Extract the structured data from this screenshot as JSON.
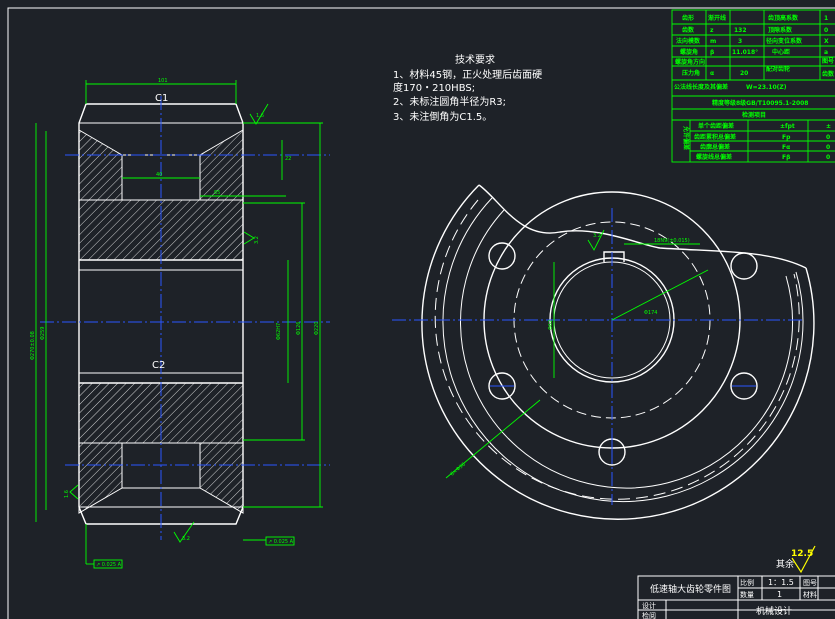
{
  "tech_requirements": {
    "title": "技术要求",
    "line1": "1、材料45钢，正火处理后齿面硬",
    "line2": "度170・210HBS;",
    "line3": "2、未标注圆角半径为R3;",
    "line4": "3、未注倒角为C1.5。"
  },
  "section_view": {
    "chamfer_top": "C1",
    "chamfer_mid": "C2",
    "roughness_top": "1.6",
    "roughness_right": "3.2",
    "roughness_bottom": "3.2",
    "roughness_left": "1.6",
    "dim_top_width": "101",
    "dim_inner_a": "40",
    "dim_inner_b": "85",
    "dim_inner_c": "22",
    "dim_left_outer": "Φ270±0.08",
    "dim_left_inner": "Φ259",
    "dim_right_1": "Φ62H7",
    "dim_right_2": "Φ126",
    "dim_right_3": "Φ220",
    "tolerance_frame_1": "↗ 0.025 A",
    "tolerance_frame_2": "↗ 0.025 A"
  },
  "front_view": {
    "roughness_keyway": "3.2",
    "keyway_dim": "18N9(±0.015)",
    "dim_bore": "Φ62",
    "dim_radius": "Φ174",
    "dim_hole": "6×Φ36"
  },
  "param_table": {
    "rows": [
      [
        "齿形",
        "渐开线",
        "齿顶高系数",
        "1"
      ],
      [
        "齿数",
        "z",
        "顶隙系数",
        "0"
      ],
      [
        "法向模数",
        "m",
        "径向变位系数",
        "X"
      ],
      [
        "螺旋角",
        "β",
        "中心距",
        "a"
      ],
      [
        "螺旋角方向",
        "",
        "配对齿轮",
        "图号"
      ],
      [
        "压力角",
        "α",
        "",
        "齿数"
      ]
    ],
    "values": {
      "z": "132",
      "m": "3",
      "beta": "11.018°",
      "alpha": "20"
    },
    "row_7": "公法线长度及其偏差",
    "row_7_value": "W=23.10(Z)",
    "accuracy": "精度等级8级GB/T10095.1-2008",
    "check_title": "检测项目",
    "allow_label": "允许偏差",
    "check_rows": [
      [
        "单个齿距偏差",
        "±fpt",
        "±"
      ],
      [
        "齿距累积总偏差",
        "Fp",
        "0"
      ],
      [
        "齿廓总偏差",
        "Fα",
        "0"
      ],
      [
        "螺旋线总偏差",
        "Fβ",
        "0"
      ]
    ]
  },
  "roughness_other": {
    "value": "12.5",
    "label": "其余"
  },
  "title_block": {
    "drawing_name": "低速轴大齿轮零件图",
    "scale_label": "比例",
    "scale_value": "1：1.5",
    "drawing_no_label": "图号",
    "qty_label": "数量",
    "qty_value": "1",
    "material_label": "材料",
    "design_label": "设计",
    "check_label": "检阅",
    "course": "机械设计"
  },
  "colors": {
    "background": "#1e2228",
    "outline": "#ffffff",
    "dimension": "#00ff00",
    "centerline": "#2a55ff",
    "highlight": "#ffff00"
  }
}
